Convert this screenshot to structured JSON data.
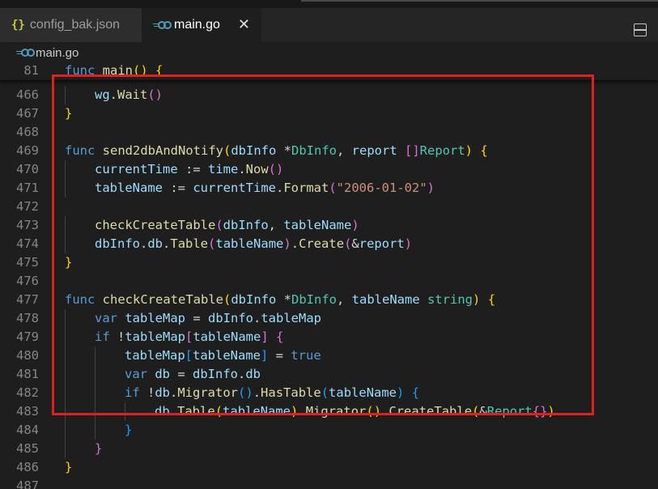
{
  "tabs": [
    {
      "label": "config_bak.json",
      "icon": "json-icon",
      "active": false
    },
    {
      "label": "main.go",
      "icon": "go-icon",
      "active": true
    }
  ],
  "tab_icons": {
    "json_glyph": "{}",
    "close_glyph": "✕"
  },
  "breadcrumb": {
    "file": "main.go"
  },
  "sticky_line": {
    "number": "81"
  },
  "line_numbers": [
    "466",
    "467",
    "468",
    "469",
    "470",
    "471",
    "472",
    "473",
    "474",
    "475",
    "476",
    "477",
    "478",
    "479",
    "480",
    "481",
    "482",
    "483",
    "484",
    "485",
    "486",
    "487"
  ],
  "code_lines": [
    {
      "n": "81",
      "indent": 0,
      "tokens": [
        [
          "k",
          "func "
        ],
        [
          "f",
          "main"
        ],
        [
          "b1",
          "() {"
        ]
      ]
    },
    {
      "n": "466",
      "indent": 1,
      "tokens": [
        [
          "v",
          "wg"
        ],
        [
          "o",
          "."
        ],
        [
          "f",
          "Wait"
        ],
        [
          "b2",
          "()"
        ]
      ]
    },
    {
      "n": "467",
      "indent": 0,
      "tokens": [
        [
          "b1",
          "}"
        ]
      ]
    },
    {
      "n": "468",
      "indent": 0,
      "tokens": []
    },
    {
      "n": "469",
      "indent": 0,
      "tokens": [
        [
          "k",
          "func "
        ],
        [
          "f",
          "send2dbAndNotify"
        ],
        [
          "b1",
          "("
        ],
        [
          "v",
          "dbInfo "
        ],
        [
          "o",
          "*"
        ],
        [
          "t",
          "DbInfo"
        ],
        [
          "o",
          ", "
        ],
        [
          "v",
          "report "
        ],
        [
          "b2",
          "[]"
        ],
        [
          "t",
          "Report"
        ],
        [
          "b1",
          ")"
        ],
        [
          "o",
          " "
        ],
        [
          "b1",
          "{"
        ]
      ]
    },
    {
      "n": "470",
      "indent": 1,
      "tokens": [
        [
          "v",
          "currentTime "
        ],
        [
          "o",
          ":= "
        ],
        [
          "v",
          "time"
        ],
        [
          "o",
          "."
        ],
        [
          "f",
          "Now"
        ],
        [
          "b2",
          "()"
        ]
      ]
    },
    {
      "n": "471",
      "indent": 1,
      "tokens": [
        [
          "v",
          "tableName "
        ],
        [
          "o",
          ":= "
        ],
        [
          "v",
          "currentTime"
        ],
        [
          "o",
          "."
        ],
        [
          "f",
          "Format"
        ],
        [
          "b2",
          "("
        ],
        [
          "s",
          "\"2006-01-02\""
        ],
        [
          "b2",
          ")"
        ]
      ]
    },
    {
      "n": "472",
      "indent": 0,
      "tokens": []
    },
    {
      "n": "473",
      "indent": 1,
      "tokens": [
        [
          "f",
          "checkCreateTable"
        ],
        [
          "b2",
          "("
        ],
        [
          "v",
          "dbInfo"
        ],
        [
          "o",
          ", "
        ],
        [
          "v",
          "tableName"
        ],
        [
          "b2",
          ")"
        ]
      ]
    },
    {
      "n": "474",
      "indent": 1,
      "tokens": [
        [
          "v",
          "dbInfo"
        ],
        [
          "o",
          "."
        ],
        [
          "v",
          "db"
        ],
        [
          "o",
          "."
        ],
        [
          "f",
          "Table"
        ],
        [
          "b2",
          "("
        ],
        [
          "v",
          "tableName"
        ],
        [
          "b2",
          ")"
        ],
        [
          "o",
          "."
        ],
        [
          "f",
          "Create"
        ],
        [
          "b2",
          "("
        ],
        [
          "o",
          "&"
        ],
        [
          "v",
          "report"
        ],
        [
          "b2",
          ")"
        ]
      ]
    },
    {
      "n": "475",
      "indent": 0,
      "tokens": [
        [
          "b1",
          "}"
        ]
      ]
    },
    {
      "n": "476",
      "indent": 0,
      "tokens": []
    },
    {
      "n": "477",
      "indent": 0,
      "tokens": [
        [
          "k",
          "func "
        ],
        [
          "f",
          "checkCreateTable"
        ],
        [
          "b1",
          "("
        ],
        [
          "v",
          "dbInfo "
        ],
        [
          "o",
          "*"
        ],
        [
          "t",
          "DbInfo"
        ],
        [
          "o",
          ", "
        ],
        [
          "v",
          "tableName "
        ],
        [
          "t",
          "string"
        ],
        [
          "b1",
          ")"
        ],
        [
          "o",
          " "
        ],
        [
          "b1",
          "{"
        ]
      ]
    },
    {
      "n": "478",
      "indent": 1,
      "tokens": [
        [
          "k",
          "var "
        ],
        [
          "v",
          "tableMap "
        ],
        [
          "o",
          "= "
        ],
        [
          "v",
          "dbInfo"
        ],
        [
          "o",
          "."
        ],
        [
          "v",
          "tableMap"
        ]
      ]
    },
    {
      "n": "479",
      "indent": 1,
      "tokens": [
        [
          "k",
          "if "
        ],
        [
          "o",
          "!"
        ],
        [
          "v",
          "tableMap"
        ],
        [
          "b2",
          "["
        ],
        [
          "v",
          "tableName"
        ],
        [
          "b2",
          "]"
        ],
        [
          "o",
          " "
        ],
        [
          "b2",
          "{"
        ]
      ]
    },
    {
      "n": "480",
      "indent": 2,
      "tokens": [
        [
          "v",
          "tableMap"
        ],
        [
          "b3",
          "["
        ],
        [
          "v",
          "tableName"
        ],
        [
          "b3",
          "]"
        ],
        [
          "o",
          " = "
        ],
        [
          "k",
          "true"
        ]
      ]
    },
    {
      "n": "481",
      "indent": 2,
      "tokens": [
        [
          "k",
          "var "
        ],
        [
          "v",
          "db "
        ],
        [
          "o",
          "= "
        ],
        [
          "v",
          "dbInfo"
        ],
        [
          "o",
          "."
        ],
        [
          "v",
          "db"
        ]
      ]
    },
    {
      "n": "482",
      "indent": 2,
      "tokens": [
        [
          "k",
          "if "
        ],
        [
          "o",
          "!"
        ],
        [
          "v",
          "db"
        ],
        [
          "o",
          "."
        ],
        [
          "f",
          "Migrator"
        ],
        [
          "b3",
          "()"
        ],
        [
          "o",
          "."
        ],
        [
          "f",
          "HasTable"
        ],
        [
          "b3",
          "("
        ],
        [
          "v",
          "tableName"
        ],
        [
          "b3",
          ")"
        ],
        [
          "o",
          " "
        ],
        [
          "b3",
          "{"
        ]
      ]
    },
    {
      "n": "483",
      "indent": 3,
      "tokens": [
        [
          "v",
          "db"
        ],
        [
          "o",
          "."
        ],
        [
          "f",
          "Table"
        ],
        [
          "b1",
          "("
        ],
        [
          "v",
          "tableName"
        ],
        [
          "b1",
          ")"
        ],
        [
          "o",
          "."
        ],
        [
          "f",
          "Migrator"
        ],
        [
          "b1",
          "()"
        ],
        [
          "o",
          "."
        ],
        [
          "f",
          "CreateTable"
        ],
        [
          "b1",
          "("
        ],
        [
          "o",
          "&"
        ],
        [
          "t",
          "Report"
        ],
        [
          "b2",
          "{}"
        ],
        [
          "b1",
          ")"
        ]
      ]
    },
    {
      "n": "484",
      "indent": 2,
      "tokens": [
        [
          "b3",
          "}"
        ]
      ]
    },
    {
      "n": "485",
      "indent": 1,
      "tokens": [
        [
          "b2",
          "}"
        ]
      ]
    },
    {
      "n": "486",
      "indent": 0,
      "tokens": [
        [
          "b1",
          "}"
        ]
      ]
    },
    {
      "n": "487",
      "indent": 0,
      "tokens": []
    }
  ],
  "colors": {
    "highlight_border": "#e02020",
    "keyword": "#569cd6",
    "function": "#dcdcaa",
    "variable": "#9cdcfe",
    "type": "#4ec9b0",
    "string": "#ce9178"
  }
}
